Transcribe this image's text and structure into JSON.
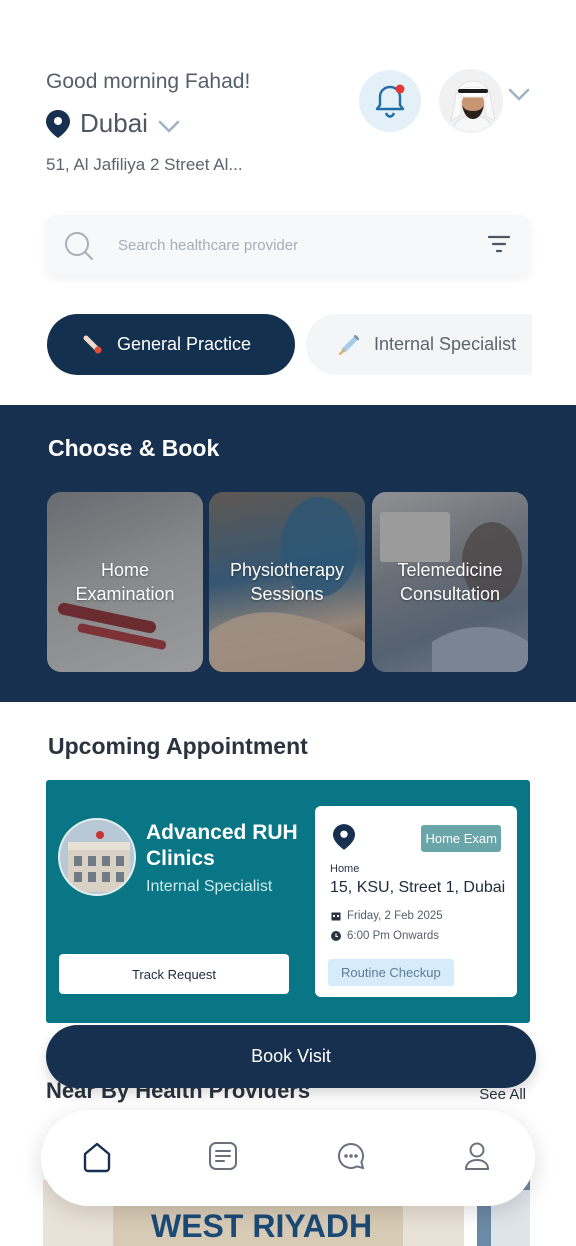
{
  "header": {
    "greeting": "Good morning Fahad!",
    "city": "Dubai",
    "address": "51, Al Jafiliya 2 Street Al...",
    "notification_dot_color": "#e53935"
  },
  "search": {
    "placeholder": "Search healthcare provider"
  },
  "categories": [
    {
      "label": "General Practice",
      "icon": "thermometer-icon",
      "selected": true
    },
    {
      "label": "Internal Specialist",
      "icon": "syringe-icon",
      "selected": false
    }
  ],
  "choose_book": {
    "title": "Choose & Book",
    "cards": [
      {
        "line1": "Home",
        "line2": "Examination"
      },
      {
        "line1": "Physiotherapy",
        "line2": "Sessions"
      },
      {
        "line1": "Telemedicine",
        "line2": "Consultation"
      }
    ]
  },
  "upcoming": {
    "title": "Upcoming Appointment",
    "clinic_name": "Advanced RUH Clinics",
    "clinic_type": "Internal Specialist",
    "track_label": "Track Request",
    "tag": "Home Exam",
    "address_label": "Home",
    "address": "15, KSU, Street 1, Dubai",
    "date": "Friday, 2 Feb 2025",
    "time": "6:00 Pm Onwards",
    "reason": "Routine Checkup"
  },
  "book_visit_label": "Book Visit",
  "nearby": {
    "title": "Near By Health Providers",
    "see_all": "See All",
    "provider_sign": "WEST RIYADH"
  },
  "nav": {
    "items": [
      "home-icon",
      "bookings-icon",
      "chat-icon",
      "profile-icon"
    ]
  },
  "colors": {
    "primary": "#17304f",
    "teal": "#087684",
    "tag": "#6aa5a9"
  }
}
